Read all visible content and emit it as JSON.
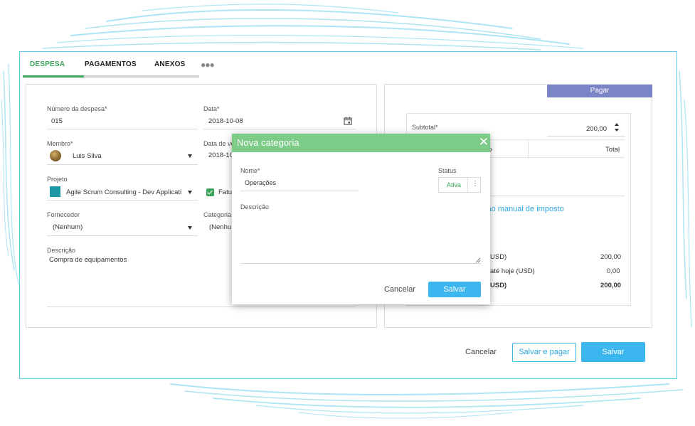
{
  "tabs": {
    "items": [
      {
        "label": "DESPESA",
        "active": true
      },
      {
        "label": "PAGAMENTOS",
        "active": false
      },
      {
        "label": "ANEXOS",
        "active": false
      }
    ],
    "more_icon": "ellipsis-icon"
  },
  "expense_form": {
    "numero": {
      "label": "Número da despesa*",
      "value": "015"
    },
    "data": {
      "label": "Data*",
      "value": "2018-10-08",
      "icon": "calendar-icon"
    },
    "membro": {
      "label": "Membro*",
      "value": "Luis Silva"
    },
    "data_vencimento": {
      "label": "Data de ve",
      "value": "2018-10"
    },
    "projeto": {
      "label": "Projeto",
      "value": "Agile Scrum Consulting - Dev Applicati",
      "color": "#1e98a5"
    },
    "faturavel": {
      "label": "Fatur",
      "checked": true
    },
    "fornecedor": {
      "label": "Fornecedor",
      "value": "(Nenhum)"
    },
    "categoria": {
      "label": "Categoria",
      "value": "(Nenhu"
    },
    "descricao": {
      "label": "Descrição",
      "value": "Compra de equipamentos"
    }
  },
  "payment_panel": {
    "pagar_label": "Pagar",
    "subtotal": {
      "label": "Subtotal*",
      "value": "200,00"
    },
    "col_headers": {
      "partial": "o",
      "total": "Total"
    },
    "tax_link": "ção manual de imposto",
    "summary": [
      {
        "label": "USD)",
        "value": "200,00",
        "bold": false
      },
      {
        "label": "até hoje (USD)",
        "value": "0,00",
        "bold": false
      },
      {
        "label": "USD)",
        "value": "200,00",
        "bold": true
      }
    ]
  },
  "footer": {
    "cancel": "Cancelar",
    "save_and_pay": "Salvar e pagar",
    "save": "Salvar"
  },
  "modal": {
    "title": "Nova categoria",
    "nome": {
      "label": "Nome*",
      "value": "Operações"
    },
    "status": {
      "label": "Status",
      "value": "Ativa"
    },
    "descricao": {
      "label": "Descrição",
      "value": ""
    },
    "cancel": "Cancelar",
    "save": "Salvar"
  },
  "colors": {
    "accent_green": "#3aa55a",
    "modal_header": "#7ccb86",
    "primary_blue": "#3bb6ee",
    "pagar_purple": "#7c84c8",
    "frame_border": "#5fcbe6"
  }
}
